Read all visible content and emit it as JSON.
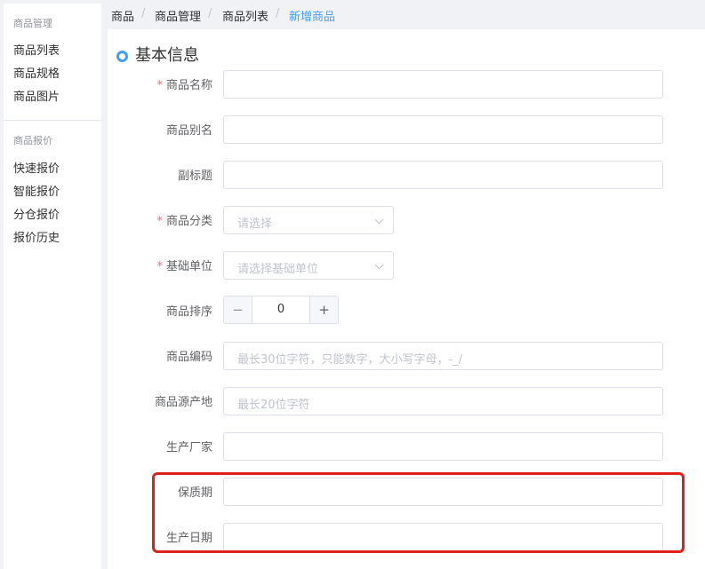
{
  "sidebar": {
    "groups": [
      {
        "title": "商品管理",
        "items": [
          "商品列表",
          "商品规格",
          "商品图片"
        ]
      },
      {
        "title": "商品报价",
        "items": [
          "快速报价",
          "智能报价",
          "分仓报价",
          "报价历史"
        ]
      }
    ]
  },
  "breadcrumb": [
    "商品",
    "商品管理",
    "商品列表",
    "新增商品"
  ],
  "breadcrumb_separator": "/",
  "section": {
    "title": "基本信息"
  },
  "form": {
    "required_mark": "*",
    "product_name": {
      "label": "商品名称",
      "value": ""
    },
    "product_alias": {
      "label": "商品别名",
      "value": ""
    },
    "subtitle": {
      "label": "副标题",
      "value": ""
    },
    "category": {
      "label": "商品分类",
      "placeholder": "请选择"
    },
    "base_unit": {
      "label": "基础单位",
      "placeholder": "请选择基础单位"
    },
    "sort": {
      "label": "商品排序",
      "value": "0",
      "minus": "−",
      "plus": "+"
    },
    "code": {
      "label": "商品编码",
      "placeholder": "最长30位字符，只能数字，大小写字母，-_/"
    },
    "origin": {
      "label": "商品源产地",
      "placeholder": "最长20位字符"
    },
    "manufacturer": {
      "label": "生产厂家",
      "value": ""
    },
    "shelf_life": {
      "label": "保质期",
      "value": ""
    },
    "production_date": {
      "label": "生产日期",
      "value": ""
    }
  },
  "colors": {
    "accent": "#409eff",
    "required": "#f56c6c",
    "highlight": "#e0201b"
  },
  "icons": {
    "section_marker": "circle-dot-icon",
    "select_arrow": "chevron-down-icon"
  }
}
